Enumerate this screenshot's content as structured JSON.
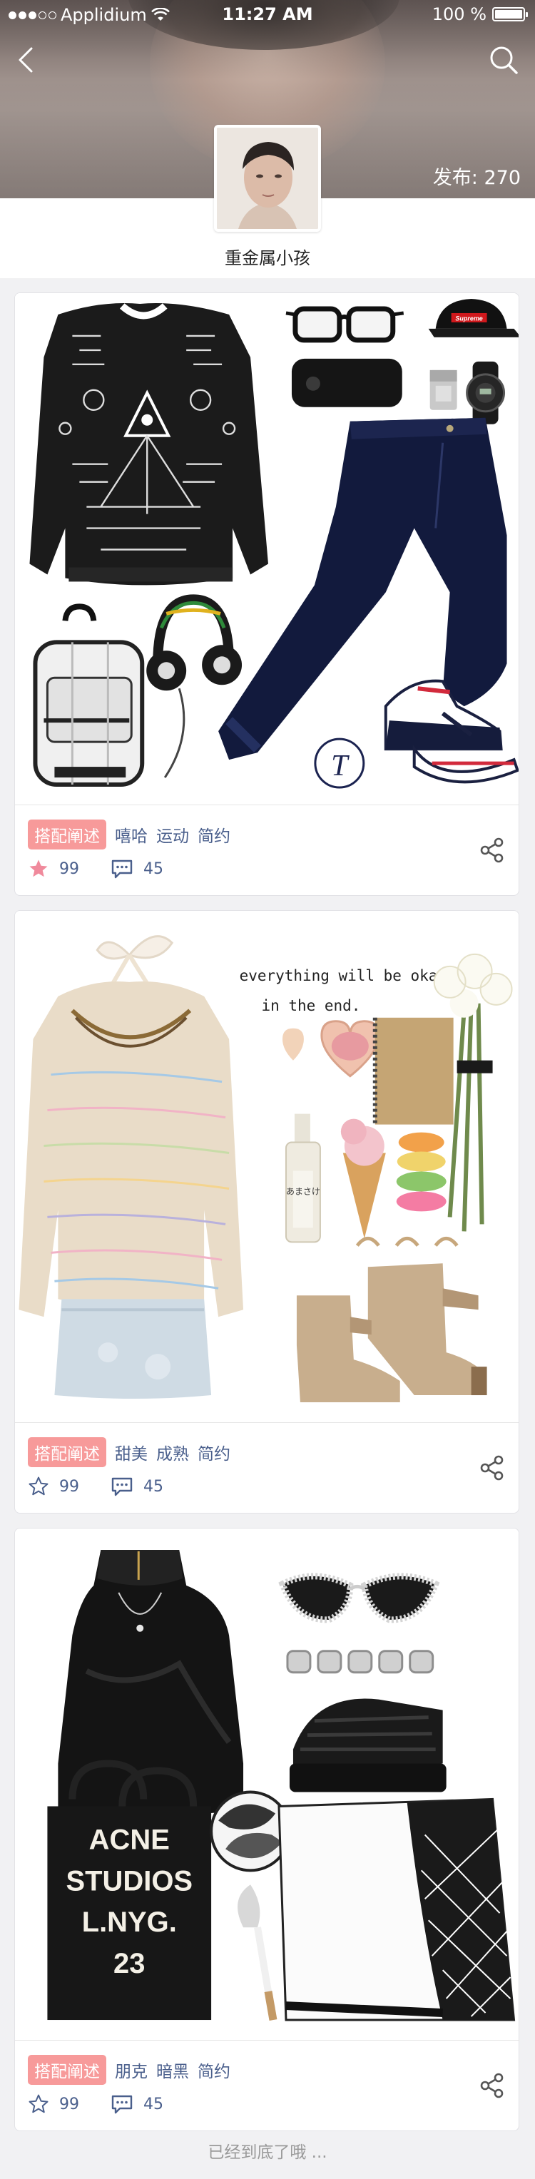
{
  "status_bar": {
    "carrier": "Applidium",
    "time": "11:27 AM",
    "battery": "100 %"
  },
  "header": {
    "post_count": "发布: 270",
    "username": "重金属小孩"
  },
  "posts": [
    {
      "badge": "搭配阐述",
      "tags": [
        "嘻哈",
        "运动",
        "简约"
      ],
      "likes": "99",
      "comments": "45",
      "liked": true
    },
    {
      "badge": "搭配阐述",
      "tags": [
        "甜美",
        "成熟",
        "简约"
      ],
      "likes": "99",
      "comments": "45",
      "liked": false,
      "caption_line1": "everything will be okay",
      "caption_line2": "in the end.",
      "sake_label": "あまさけ"
    },
    {
      "badge": "搭配阐述",
      "tags": [
        "朋克",
        "暗黑",
        "简约"
      ],
      "likes": "99",
      "comments": "45",
      "liked": false,
      "bag_text": [
        "ACNE",
        "STUDIOS",
        "L.NYG.",
        "23"
      ]
    }
  ],
  "footer_text": "已经到底了哦 ...",
  "colors": {
    "badge": "#f79a9a",
    "tag_text": "#4a5f8c",
    "liked_star": "#f08a9c"
  },
  "icons": {
    "back": "chevron-left-icon",
    "search": "search-icon",
    "wifi": "wifi-icon",
    "star": "star-icon",
    "comment": "comment-icon",
    "share": "share-icon"
  }
}
